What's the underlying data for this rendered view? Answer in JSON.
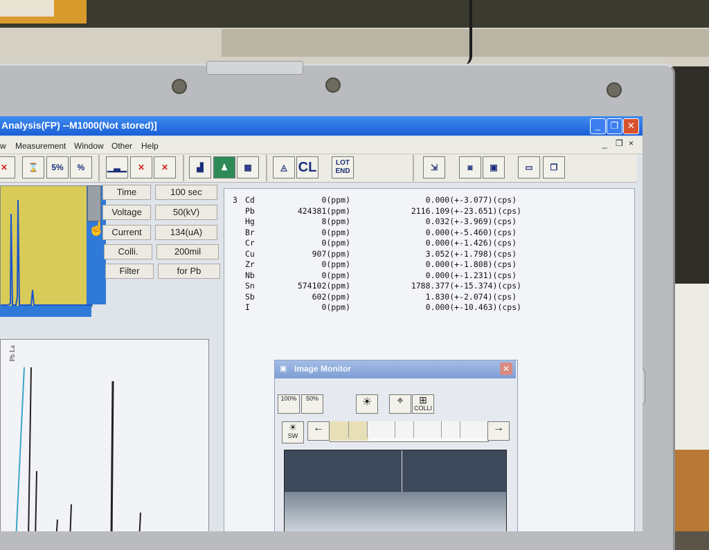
{
  "window": {
    "title": "Analysis(FP)   --M1000(Not stored)]"
  },
  "menu": [
    "w",
    "Measurement",
    "Window",
    "Other",
    "Help"
  ],
  "window_controls": {
    "minimize": "_",
    "restore": "❐",
    "close": "✕"
  },
  "toolbar": {
    "five_pct": "5%",
    "cl_label": "CL",
    "lot_end": "LOT\nEND"
  },
  "parameters": [
    {
      "label": "Time",
      "value": "100 sec"
    },
    {
      "label": "Voltage",
      "value": "50(kV)"
    },
    {
      "label": "Current",
      "value": "134(uA)"
    },
    {
      "label": "Colli.",
      "value": "200mil"
    },
    {
      "label": "Filter",
      "value": "for Pb"
    }
  ],
  "results": {
    "index": "3",
    "rows": [
      {
        "el": "Cd",
        "ppm": "0(ppm)",
        "cps": "0.000(+-",
        "err": "3.077)(cps)"
      },
      {
        "el": "Pb",
        "ppm": "424381(ppm)",
        "cps": "2116.109(+-",
        "err": "23.651)(cps)"
      },
      {
        "el": "Hg",
        "ppm": "8(ppm)",
        "cps": "0.032(+-",
        "err": "3.969)(cps)"
      },
      {
        "el": "Br",
        "ppm": "0(ppm)",
        "cps": "0.000(+-",
        "err": "5.460)(cps)"
      },
      {
        "el": "Cr",
        "ppm": "0(ppm)",
        "cps": "0.000(+-",
        "err": "1.426)(cps)"
      },
      {
        "el": "Cu",
        "ppm": "907(ppm)",
        "cps": "3.052(+-",
        "err": "1.798)(cps)"
      },
      {
        "el": "Zr",
        "ppm": "0(ppm)",
        "cps": "0.000(+-",
        "err": "1.808)(cps)"
      },
      {
        "el": "Nb",
        "ppm": "0(ppm)",
        "cps": "0.000(+-",
        "err": "1.231)(cps)"
      },
      {
        "el": "Sn",
        "ppm": "574102(ppm)",
        "cps": "1788.377(+-",
        "err": "15.374)(cps)"
      },
      {
        "el": "Sb",
        "ppm": "602(ppm)",
        "cps": "1.830(+-",
        "err": "2.074)(cps)"
      },
      {
        "el": "I",
        "ppm": "0(ppm)",
        "cps": "0.000(+-",
        "err": "10.463)(cps)"
      }
    ]
  },
  "spectrum": {
    "peak_label": "Pb La"
  },
  "image_monitor": {
    "title": "Image Monitor",
    "zoom_100": "100%",
    "zoom_50": "50%",
    "colli": "COLLI",
    "sw": "SW",
    "left_arrow": "←",
    "right_arrow": "→"
  },
  "colors": {
    "titlebar": "#1a5fd6",
    "spectrum_bg": "#d8cb57",
    "accent_blue": "#2f79d8"
  }
}
